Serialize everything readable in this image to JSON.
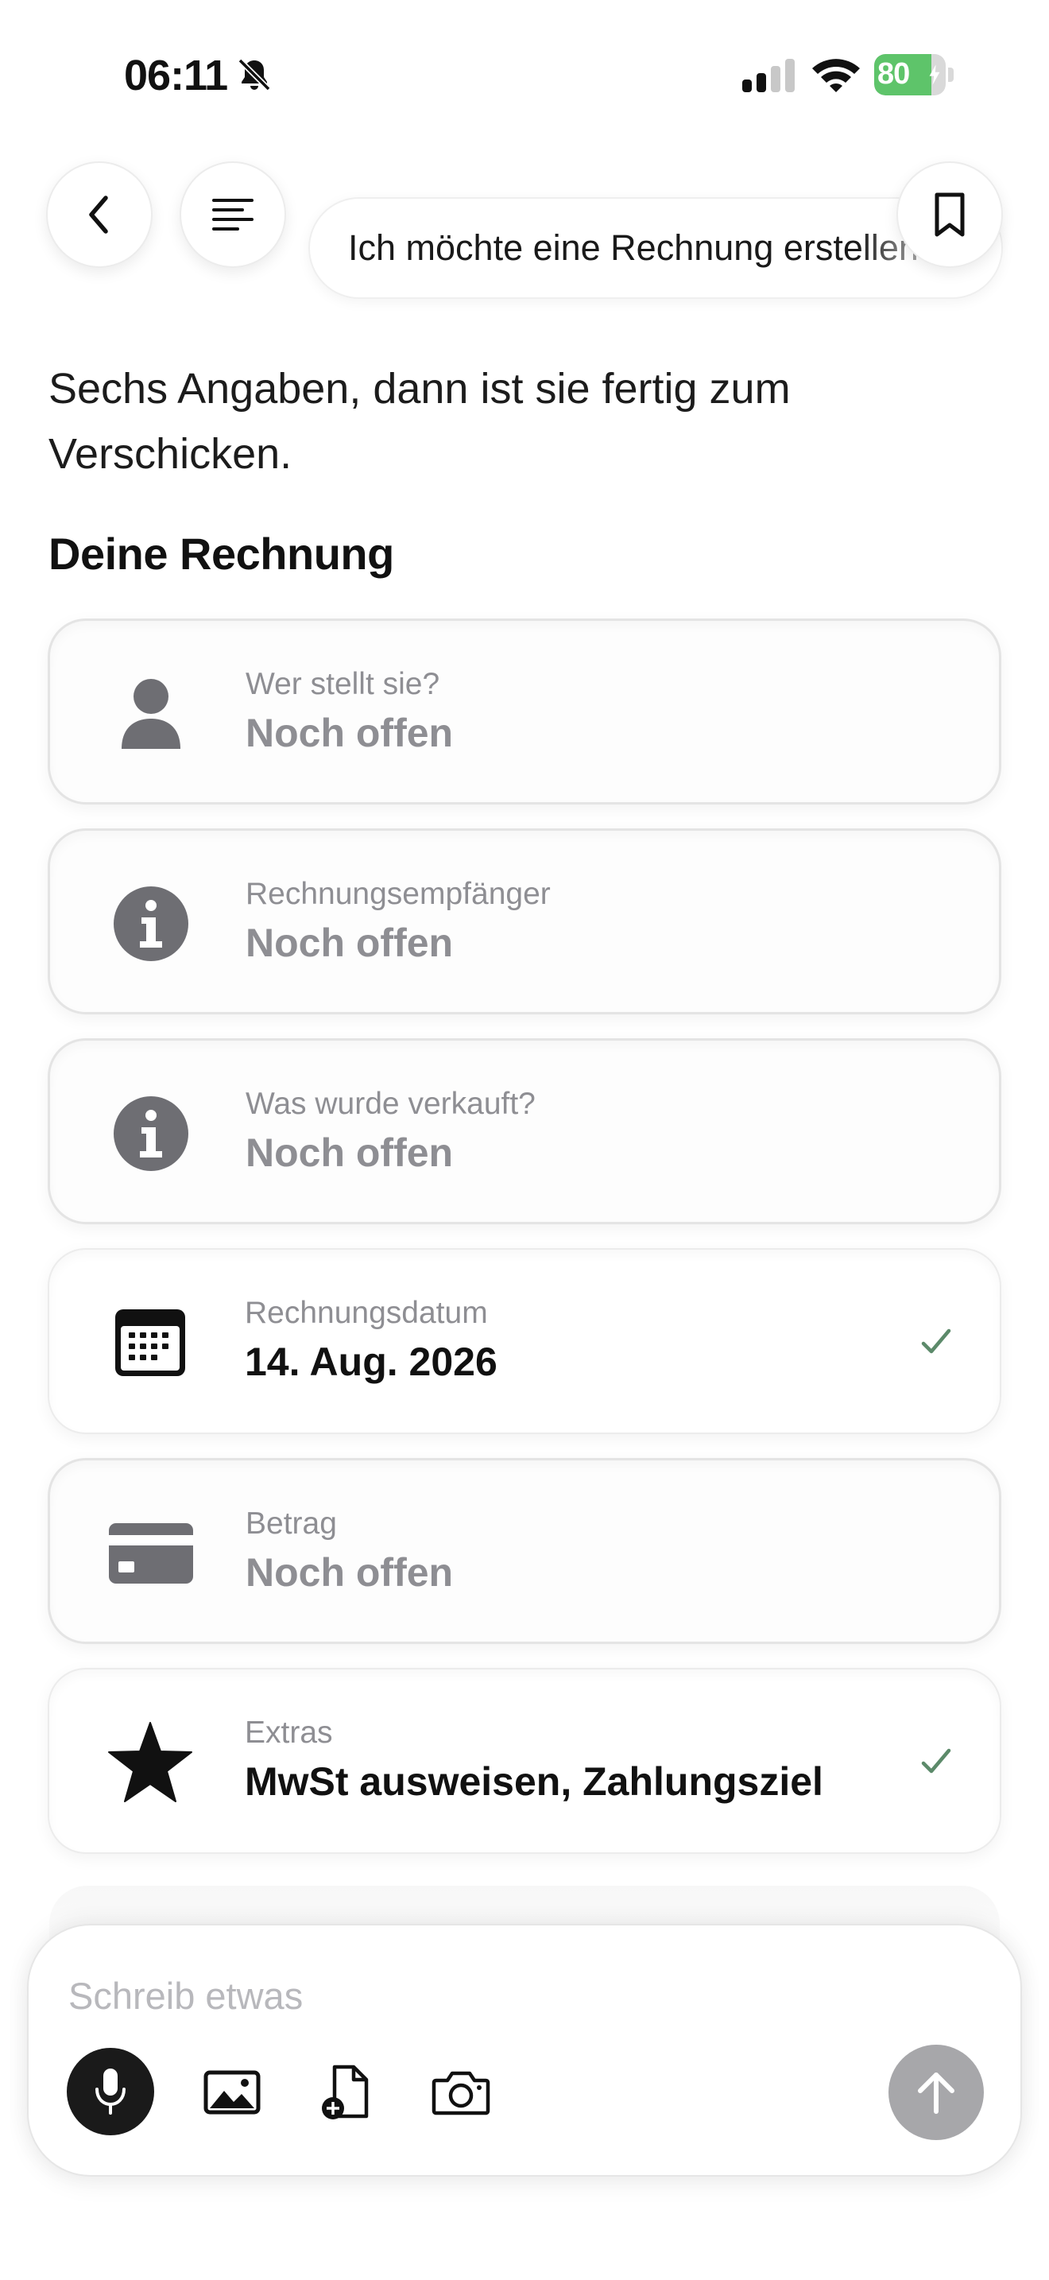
{
  "status_bar": {
    "time": "06:11",
    "battery_percent": 80,
    "battery_label": "80",
    "icons": [
      "bell-slash-icon",
      "signal-icon",
      "wifi-icon",
      "battery-icon",
      "charging-bolt-icon"
    ]
  },
  "header": {
    "conversation_title": "Ich möchte eine Rechnung erstellen",
    "icons": [
      "chevron-left-icon",
      "list-icon",
      "bookmark-icon"
    ]
  },
  "intro_text": "Sechs Angaben, dann ist sie fertig zum Verschicken.",
  "section_title": "Deine Rechnung",
  "cards": [
    {
      "label": "Wer stellt sie?",
      "value": "Noch offen",
      "icon": "person-icon",
      "complete": false
    },
    {
      "label": "Rechnungsempfänger",
      "value": "Noch offen",
      "icon": "info-icon",
      "complete": false
    },
    {
      "label": "Was wurde verkauft?",
      "value": "Noch offen",
      "icon": "info-icon",
      "complete": false
    },
    {
      "label": "Rechnungsdatum",
      "value": "14. Aug. 2026",
      "icon": "calendar-icon",
      "complete": true
    },
    {
      "label": "Betrag",
      "value": "Noch offen",
      "icon": "credit-card-icon",
      "complete": false
    },
    {
      "label": "Extras",
      "value": "MwSt ausweisen, Zahlungsziel",
      "icon": "star-icon",
      "complete": true
    }
  ],
  "composer": {
    "placeholder": "Schreib etwas",
    "icons": [
      "microphone-icon",
      "photo-icon",
      "file-add-icon",
      "camera-icon",
      "arrow-up-icon"
    ]
  },
  "colors": {
    "pending_text": "#8e8e93",
    "check_green": "#5c8a6a",
    "battery_green": "#5ec46a",
    "send_disabled": "#a7a7aa"
  }
}
